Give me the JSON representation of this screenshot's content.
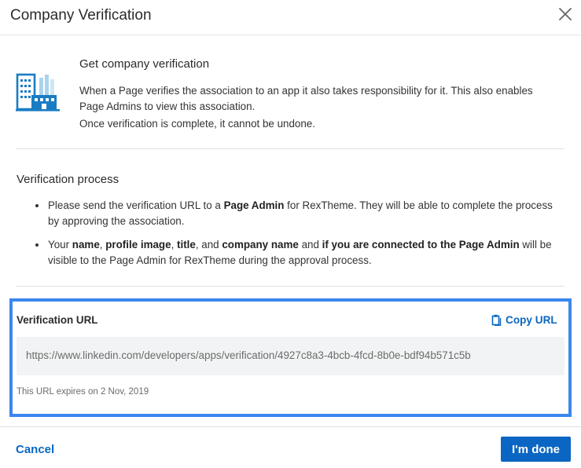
{
  "dialog": {
    "title": "Company Verification",
    "close_icon": "close-icon"
  },
  "intro": {
    "icon": "building-icon",
    "heading": "Get company verification",
    "paragraph1": "When a Page verifies the association to an app it also takes responsibility for it. This also enables Page Admins to view this association.",
    "paragraph2": "Once verification is complete, it cannot be undone."
  },
  "process": {
    "heading": "Verification process",
    "bullet1": {
      "t1": "Please send the verification URL to a ",
      "b1": "Page Admin",
      "t2": " for RexTheme. They will be able to complete the process by approving the association."
    },
    "bullet2": {
      "t1": "Your ",
      "b1": "name",
      "t2": ", ",
      "b2": "profile image",
      "t3": ", ",
      "b3": "title",
      "t4": ", and ",
      "b4": "company name",
      "t5": " and ",
      "b5": "if you are connected to the Page Admin",
      "t6": " will be visible to the Page Admin for RexTheme during the approval process."
    }
  },
  "verification_url": {
    "label": "Verification URL",
    "copy_label": "Copy URL",
    "copy_icon": "clipboard-icon",
    "url": "https://www.linkedin.com/developers/apps/verification/4927c8a3-4bcb-4fcd-8b0e-bdf94b571c5b",
    "expires": "This URL expires on 2 Nov, 2019"
  },
  "footer": {
    "cancel_label": "Cancel",
    "done_label": "I'm done"
  },
  "colors": {
    "accent": "#0a66c2",
    "highlight_border": "#3b86f0",
    "field_bg": "#f2f3f4"
  }
}
